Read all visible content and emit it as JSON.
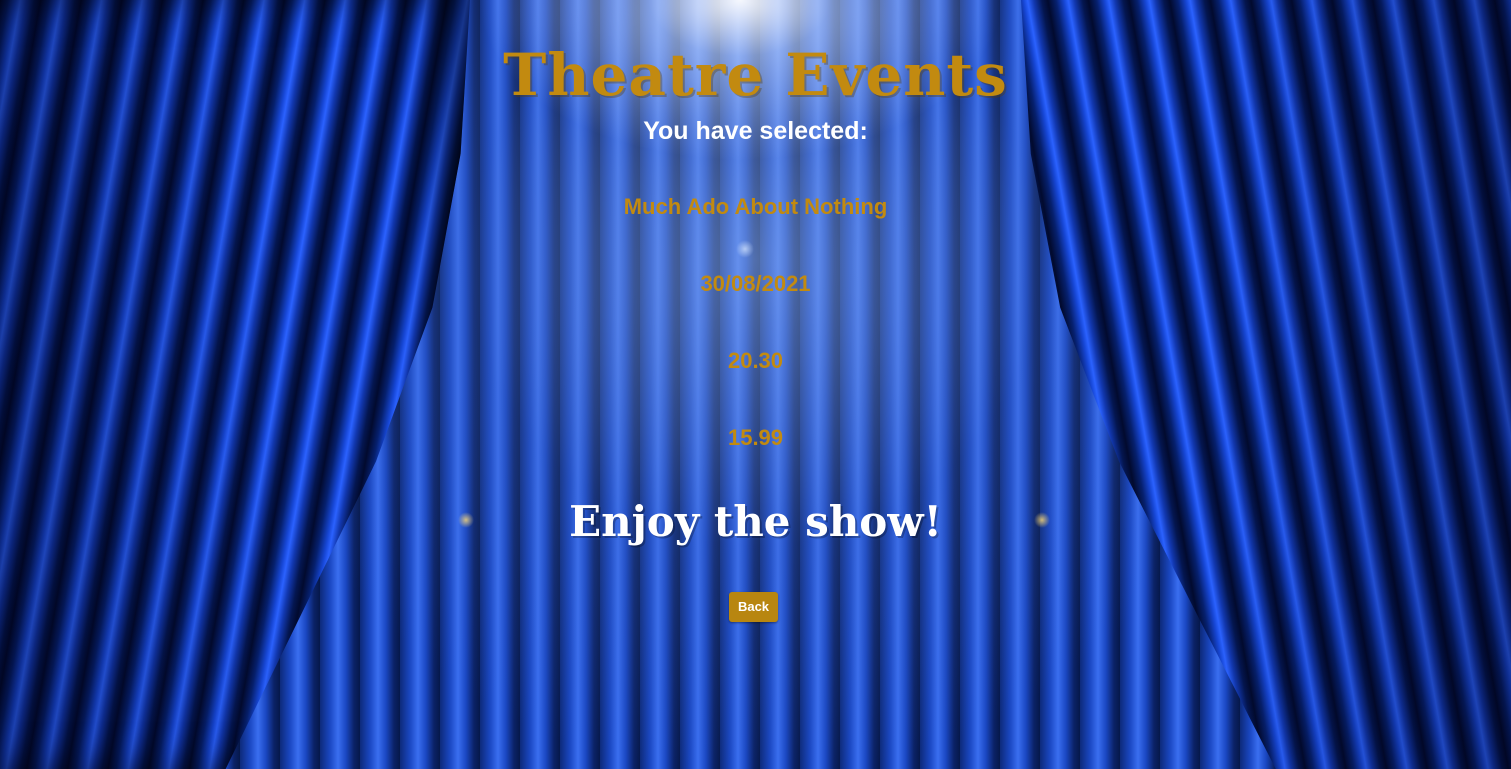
{
  "page": {
    "title": "Theatre Events",
    "subtitle": "You have selected:"
  },
  "selection": {
    "event_name": "Much Ado About Nothing",
    "date": "30/08/2021",
    "time": "20.30",
    "price": "15.99"
  },
  "message": "Enjoy the show!",
  "actions": {
    "back_label": "Back"
  },
  "colors": {
    "accent_gold": "#c28a10",
    "button_gold": "#b88610",
    "text_white": "#ffffff",
    "curtain_blue": "#1747d6"
  },
  "background": {
    "icon": "blue-stage-curtain-image"
  }
}
